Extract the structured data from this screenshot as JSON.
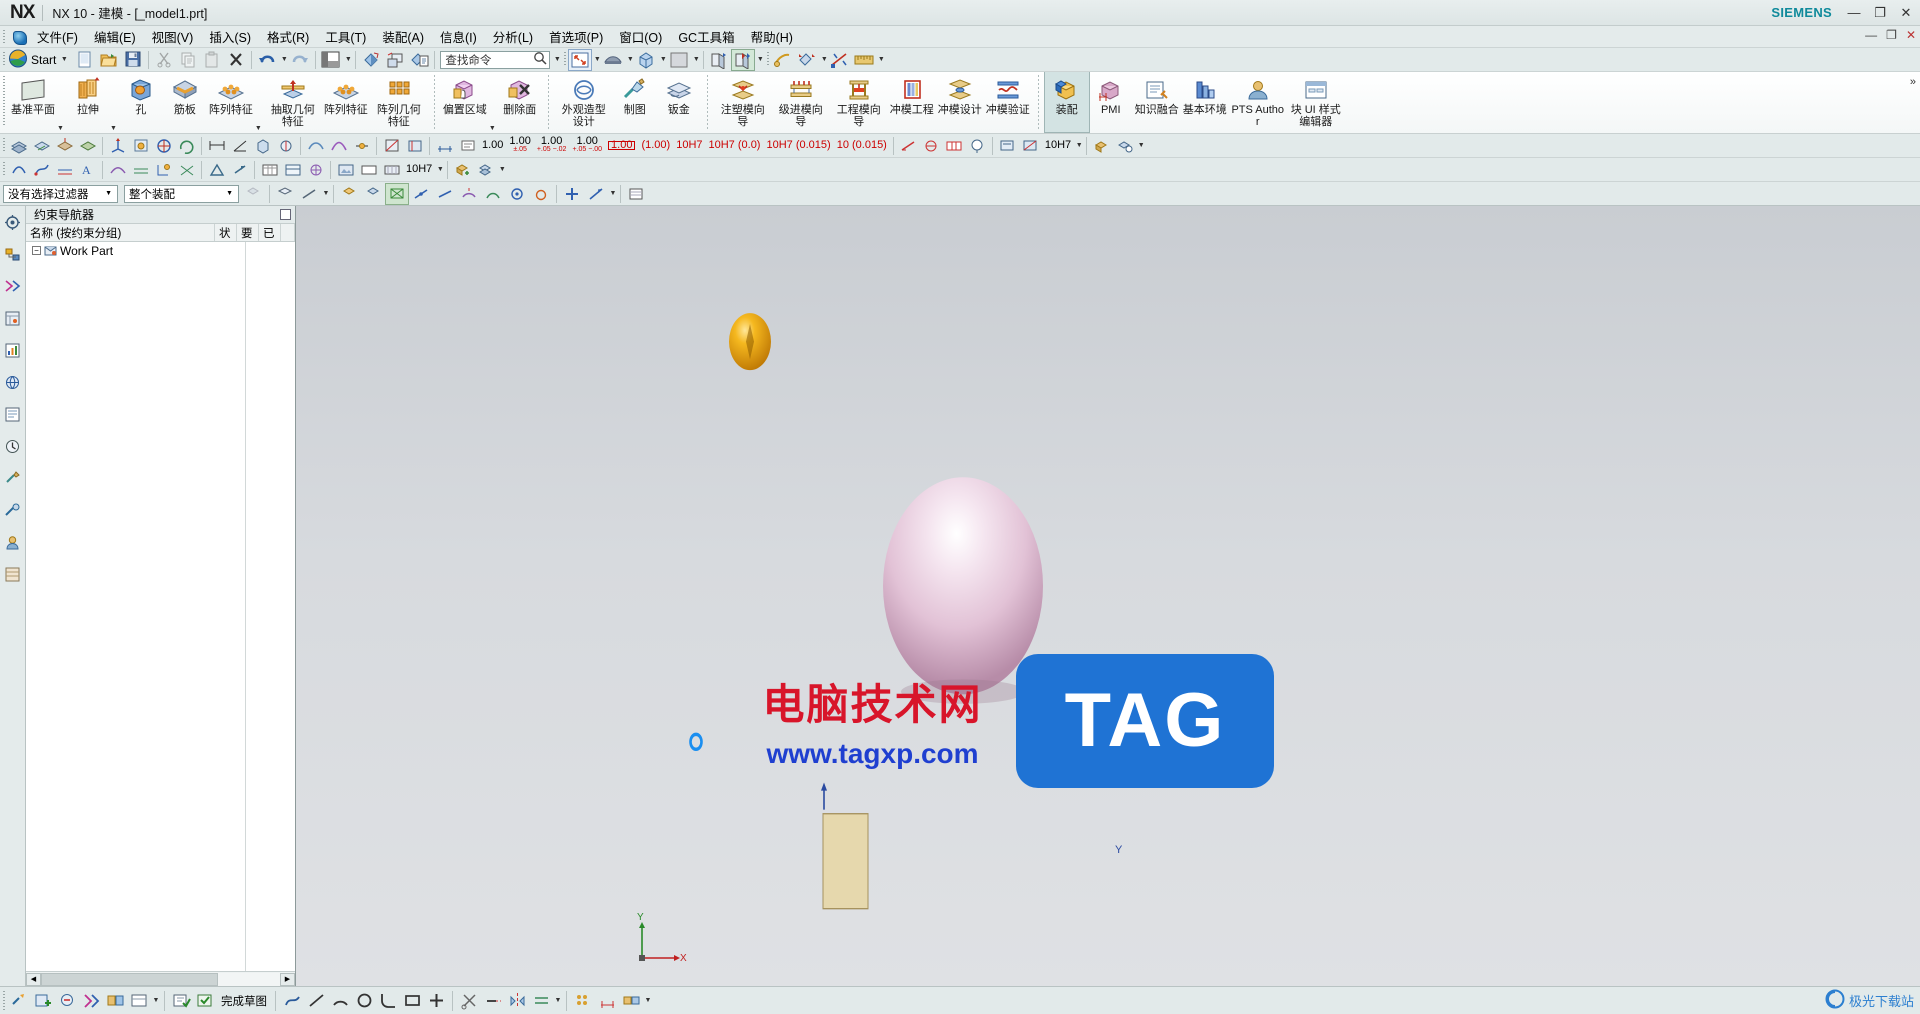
{
  "window": {
    "app_logo": "NX",
    "title": "NX 10 - 建模 - [_model1.prt]",
    "brand": "SIEMENS",
    "controls": {
      "minimize": "—",
      "maximize": "❐",
      "close": "✕"
    },
    "inner_controls": {
      "minimize": "—",
      "maximize": "❐",
      "close": "✕"
    }
  },
  "menubar": {
    "items": [
      {
        "label": "文件(F)"
      },
      {
        "label": "编辑(E)"
      },
      {
        "label": "视图(V)"
      },
      {
        "label": "插入(S)"
      },
      {
        "label": "格式(R)"
      },
      {
        "label": "工具(T)"
      },
      {
        "label": "装配(A)"
      },
      {
        "label": "信息(I)"
      },
      {
        "label": "分析(L)"
      },
      {
        "label": "首选项(P)"
      },
      {
        "label": "窗口(O)"
      },
      {
        "label": "GC工具箱"
      },
      {
        "label": "帮助(H)"
      }
    ]
  },
  "quick_toolbar": {
    "start_label": "Start",
    "search": {
      "placeholder": "查找命令",
      "value": "查找命令"
    },
    "buttons": [
      {
        "name": "new-file",
        "icon": "page"
      },
      {
        "name": "open-file",
        "icon": "folder"
      },
      {
        "name": "save-file",
        "icon": "floppy"
      },
      {
        "name": "cut",
        "icon": "scissors"
      },
      {
        "name": "copy",
        "icon": "copy"
      },
      {
        "name": "paste",
        "icon": "clipboard"
      },
      {
        "name": "delete",
        "icon": "x"
      },
      {
        "name": "undo",
        "icon": "undo"
      },
      {
        "name": "redo",
        "icon": "redo"
      },
      {
        "name": "window-layout",
        "icon": "panes"
      },
      {
        "name": "render-style",
        "icon": "shade"
      },
      {
        "name": "transparency",
        "icon": "transp"
      },
      {
        "name": "object-display",
        "icon": "objdisp"
      },
      {
        "name": "fit-view",
        "icon": "fit"
      },
      {
        "name": "zoom-style",
        "icon": "zoomsty"
      },
      {
        "name": "orient-view",
        "icon": "cube"
      },
      {
        "name": "background",
        "icon": "bg"
      },
      {
        "name": "section-a",
        "icon": "secA"
      },
      {
        "name": "section-b",
        "icon": "secB"
      },
      {
        "name": "measure-tool",
        "icon": "measure"
      },
      {
        "name": "assembly-constraint",
        "icon": "constraint"
      },
      {
        "name": "scale-ruler",
        "icon": "ruler"
      }
    ]
  },
  "ribbon": {
    "more_indicator": "»",
    "groups": [
      {
        "name": "feature-group",
        "items": [
          {
            "label": "基准平面",
            "icon": "datum-plane",
            "dropdown": true
          },
          {
            "label": "拉伸",
            "icon": "extrude",
            "dropdown": true
          },
          {
            "label": "孔",
            "icon": "hole",
            "dropdown": false
          },
          {
            "label": "筋板",
            "icon": "rib",
            "dropdown": false
          },
          {
            "label": "阵列特征",
            "icon": "pattern-feature",
            "dropdown": true
          },
          {
            "label": "抽取几何特征",
            "icon": "extract-geometry",
            "dropdown": false
          },
          {
            "label": "阵列特征",
            "icon": "pattern-feature-2",
            "dropdown": false
          },
          {
            "label": "阵列几何特征",
            "icon": "pattern-geometry",
            "dropdown": false
          }
        ]
      },
      {
        "name": "synchronous-group",
        "items": [
          {
            "label": "偏置区域",
            "icon": "offset-region",
            "dropdown": true
          },
          {
            "label": "删除面",
            "icon": "delete-face",
            "dropdown": false
          }
        ]
      },
      {
        "name": "application-group",
        "items": [
          {
            "label": "外观造型设计",
            "icon": "appearance-design",
            "dropdown": false
          },
          {
            "label": "制图",
            "icon": "drafting",
            "dropdown": false
          },
          {
            "label": "钣金",
            "icon": "sheet-metal",
            "dropdown": false
          }
        ]
      },
      {
        "name": "mold-group",
        "items": [
          {
            "label": "注塑模向导",
            "icon": "mold-wizard",
            "dropdown": false
          },
          {
            "label": "级进模向导",
            "icon": "progressive-die",
            "dropdown": false
          },
          {
            "label": "工程模向导",
            "icon": "die-engineering",
            "dropdown": false
          },
          {
            "label": "冲模工程",
            "icon": "stamping-die",
            "dropdown": false
          },
          {
            "label": "冲模设计",
            "icon": "die-design",
            "dropdown": false
          },
          {
            "label": "冲模验证",
            "icon": "die-validation",
            "dropdown": false
          }
        ]
      },
      {
        "name": "assembly-group",
        "items": [
          {
            "label": "装配",
            "icon": "assembly",
            "selected": true
          },
          {
            "label": "PMI",
            "icon": "pmi",
            "dropdown": false
          },
          {
            "label": "知识融合",
            "icon": "knowledge-fusion",
            "dropdown": false
          },
          {
            "label": "基本环境",
            "icon": "gateway",
            "dropdown": false
          },
          {
            "label": "PTS Author",
            "icon": "pts-author",
            "dropdown": false
          },
          {
            "label": "块 UI 样式编辑器",
            "icon": "block-ui-styler",
            "dropdown": false
          }
        ]
      }
    ]
  },
  "tool_rows": {
    "row1_tolerances": [
      "1.00",
      "1.00",
      "1.00",
      "1.00",
      "1.00",
      "(1.00)"
    ],
    "row1_tol_subs": [
      "",
      "±.05",
      "+.05 −.02",
      "+.05 −.00",
      "",
      ""
    ],
    "row1_fits": [
      "10H7",
      "10H7 (0.0)",
      "10H7 (0.015)",
      "10 (0.015)"
    ],
    "row1_dims": [
      "10H7"
    ]
  },
  "filters": {
    "selection_filter": {
      "value": "没有选择过滤器"
    },
    "scope_filter": {
      "value": "整个装配"
    }
  },
  "navigator": {
    "title": "约束导航器",
    "columns": [
      {
        "label": "名称 (按约束分组)"
      },
      {
        "label": "状"
      },
      {
        "label": "要"
      },
      {
        "label": "已"
      },
      {
        "label": ""
      }
    ],
    "tree": [
      {
        "label": "Work Part",
        "expander": "−",
        "icon": "part-icon"
      }
    ]
  },
  "graphics": {
    "triad": {
      "y_axis": "Y",
      "x_axis": "X"
    },
    "wcs": {
      "y_axis": "Y",
      "x_axis": "X"
    },
    "objects": [
      {
        "name": "small-sphere",
        "color": "#e8a100"
      },
      {
        "name": "large-sphere",
        "color": "#d8b6cc"
      },
      {
        "name": "point-marker",
        "color": "#1a8ef0"
      }
    ]
  },
  "watermark": {
    "chinese": "电脑技术网",
    "url": "www.tagxp.com",
    "tag": "TAG"
  },
  "bottombar": {
    "status_label": "完成草图",
    "buttons": [
      {
        "name": "sketch-point"
      },
      {
        "name": "add-sketch"
      },
      {
        "name": "sketch-constraint"
      },
      {
        "name": "sketch-orient"
      },
      {
        "name": "sketch-assoc"
      },
      {
        "name": "finish-sketch"
      },
      {
        "name": "profile"
      },
      {
        "name": "line"
      },
      {
        "name": "arc"
      },
      {
        "name": "circle"
      },
      {
        "name": "fillet"
      },
      {
        "name": "rectangle"
      },
      {
        "name": "point"
      },
      {
        "name": "trim"
      },
      {
        "name": "extend"
      },
      {
        "name": "mirror"
      },
      {
        "name": "offset"
      },
      {
        "name": "pattern-curve"
      },
      {
        "name": "quick-dim"
      },
      {
        "name": "geometric-constraint"
      }
    ],
    "credit": {
      "name": "极光下载站",
      "site": ""
    }
  }
}
